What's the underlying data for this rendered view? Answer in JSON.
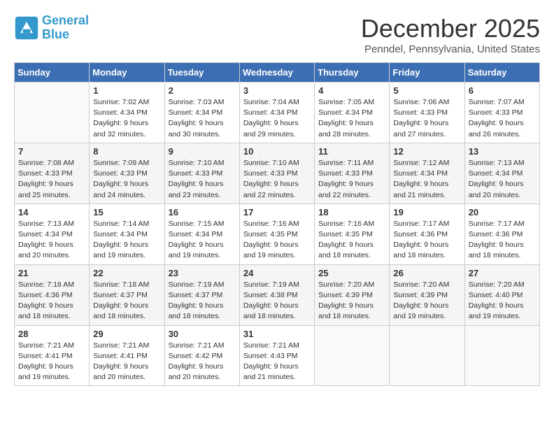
{
  "logo": {
    "line1": "General",
    "line2": "Blue"
  },
  "title": "December 2025",
  "location": "Penndel, Pennsylvania, United States",
  "weekdays": [
    "Sunday",
    "Monday",
    "Tuesday",
    "Wednesday",
    "Thursday",
    "Friday",
    "Saturday"
  ],
  "weeks": [
    [
      {
        "day": "",
        "info": ""
      },
      {
        "day": "1",
        "info": "Sunrise: 7:02 AM\nSunset: 4:34 PM\nDaylight: 9 hours and 32 minutes."
      },
      {
        "day": "2",
        "info": "Sunrise: 7:03 AM\nSunset: 4:34 PM\nDaylight: 9 hours and 30 minutes."
      },
      {
        "day": "3",
        "info": "Sunrise: 7:04 AM\nSunset: 4:34 PM\nDaylight: 9 hours and 29 minutes."
      },
      {
        "day": "4",
        "info": "Sunrise: 7:05 AM\nSunset: 4:34 PM\nDaylight: 9 hours and 28 minutes."
      },
      {
        "day": "5",
        "info": "Sunrise: 7:06 AM\nSunset: 4:33 PM\nDaylight: 9 hours and 27 minutes."
      },
      {
        "day": "6",
        "info": "Sunrise: 7:07 AM\nSunset: 4:33 PM\nDaylight: 9 hours and 26 minutes."
      }
    ],
    [
      {
        "day": "7",
        "info": "Sunrise: 7:08 AM\nSunset: 4:33 PM\nDaylight: 9 hours and 25 minutes."
      },
      {
        "day": "8",
        "info": "Sunrise: 7:09 AM\nSunset: 4:33 PM\nDaylight: 9 hours and 24 minutes."
      },
      {
        "day": "9",
        "info": "Sunrise: 7:10 AM\nSunset: 4:33 PM\nDaylight: 9 hours and 23 minutes."
      },
      {
        "day": "10",
        "info": "Sunrise: 7:10 AM\nSunset: 4:33 PM\nDaylight: 9 hours and 22 minutes."
      },
      {
        "day": "11",
        "info": "Sunrise: 7:11 AM\nSunset: 4:33 PM\nDaylight: 9 hours and 22 minutes."
      },
      {
        "day": "12",
        "info": "Sunrise: 7:12 AM\nSunset: 4:34 PM\nDaylight: 9 hours and 21 minutes."
      },
      {
        "day": "13",
        "info": "Sunrise: 7:13 AM\nSunset: 4:34 PM\nDaylight: 9 hours and 20 minutes."
      }
    ],
    [
      {
        "day": "14",
        "info": "Sunrise: 7:13 AM\nSunset: 4:34 PM\nDaylight: 9 hours and 20 minutes."
      },
      {
        "day": "15",
        "info": "Sunrise: 7:14 AM\nSunset: 4:34 PM\nDaylight: 9 hours and 19 minutes."
      },
      {
        "day": "16",
        "info": "Sunrise: 7:15 AM\nSunset: 4:34 PM\nDaylight: 9 hours and 19 minutes."
      },
      {
        "day": "17",
        "info": "Sunrise: 7:16 AM\nSunset: 4:35 PM\nDaylight: 9 hours and 19 minutes."
      },
      {
        "day": "18",
        "info": "Sunrise: 7:16 AM\nSunset: 4:35 PM\nDaylight: 9 hours and 18 minutes."
      },
      {
        "day": "19",
        "info": "Sunrise: 7:17 AM\nSunset: 4:36 PM\nDaylight: 9 hours and 18 minutes."
      },
      {
        "day": "20",
        "info": "Sunrise: 7:17 AM\nSunset: 4:36 PM\nDaylight: 9 hours and 18 minutes."
      }
    ],
    [
      {
        "day": "21",
        "info": "Sunrise: 7:18 AM\nSunset: 4:36 PM\nDaylight: 9 hours and 18 minutes."
      },
      {
        "day": "22",
        "info": "Sunrise: 7:18 AM\nSunset: 4:37 PM\nDaylight: 9 hours and 18 minutes."
      },
      {
        "day": "23",
        "info": "Sunrise: 7:19 AM\nSunset: 4:37 PM\nDaylight: 9 hours and 18 minutes."
      },
      {
        "day": "24",
        "info": "Sunrise: 7:19 AM\nSunset: 4:38 PM\nDaylight: 9 hours and 18 minutes."
      },
      {
        "day": "25",
        "info": "Sunrise: 7:20 AM\nSunset: 4:39 PM\nDaylight: 9 hours and 18 minutes."
      },
      {
        "day": "26",
        "info": "Sunrise: 7:20 AM\nSunset: 4:39 PM\nDaylight: 9 hours and 19 minutes."
      },
      {
        "day": "27",
        "info": "Sunrise: 7:20 AM\nSunset: 4:40 PM\nDaylight: 9 hours and 19 minutes."
      }
    ],
    [
      {
        "day": "28",
        "info": "Sunrise: 7:21 AM\nSunset: 4:41 PM\nDaylight: 9 hours and 19 minutes."
      },
      {
        "day": "29",
        "info": "Sunrise: 7:21 AM\nSunset: 4:41 PM\nDaylight: 9 hours and 20 minutes."
      },
      {
        "day": "30",
        "info": "Sunrise: 7:21 AM\nSunset: 4:42 PM\nDaylight: 9 hours and 20 minutes."
      },
      {
        "day": "31",
        "info": "Sunrise: 7:21 AM\nSunset: 4:43 PM\nDaylight: 9 hours and 21 minutes."
      },
      {
        "day": "",
        "info": ""
      },
      {
        "day": "",
        "info": ""
      },
      {
        "day": "",
        "info": ""
      }
    ]
  ]
}
